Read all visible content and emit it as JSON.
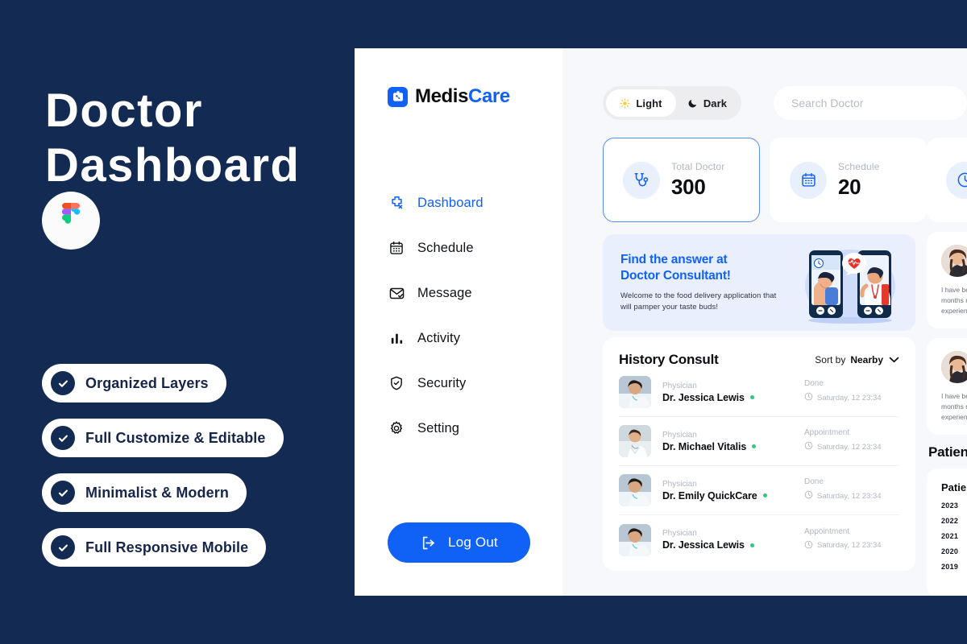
{
  "promo": {
    "title": "Doctor\nDashboard",
    "figma_icon": "figma-logo",
    "features": [
      {
        "label": "Organized Layers",
        "icon": "check-icon"
      },
      {
        "label": "Full Customize & Editable",
        "icon": "check-icon"
      },
      {
        "label": "Minimalist & Modern",
        "icon": "check-icon"
      },
      {
        "label": "Full Responsive Mobile",
        "icon": "check-icon"
      }
    ]
  },
  "colors": {
    "promo_bg": "#132a53",
    "accent_blue": "#1061f5",
    "app_bg": "#f6f8fc",
    "card_bg": "#ffffff",
    "banner_bg": "#e9effd",
    "online_green": "#2ecb7d",
    "muted_text": "#b2b6bf"
  },
  "sidebar": {
    "logo": {
      "mark_icon": "medical-bag-icon",
      "text_primary": "Medis",
      "text_accent": "Care"
    },
    "items": [
      {
        "label": "Dashboard",
        "icon": "dashboard-cross-icon",
        "active": true
      },
      {
        "label": "Schedule",
        "icon": "calendar-icon",
        "active": false
      },
      {
        "label": "Message",
        "icon": "envelope-check-icon",
        "active": false
      },
      {
        "label": "Activity",
        "icon": "bar-chart-icon",
        "active": false
      },
      {
        "label": "Security",
        "icon": "shield-check-icon",
        "active": false
      },
      {
        "label": "Setting",
        "icon": "gear-icon",
        "active": false
      }
    ],
    "logout": {
      "label": "Log Out",
      "icon": "logout-arrow-icon"
    }
  },
  "topbar": {
    "theme": {
      "light_label": "Light",
      "light_icon": "sun-icon",
      "dark_label": "Dark",
      "dark_icon": "moon-icon",
      "selected": "Light"
    },
    "search": {
      "placeholder": "Search Doctor",
      "value": "",
      "icon": "search-icon"
    }
  },
  "stats": [
    {
      "title": "Total Doctor",
      "value": "300",
      "icon": "stethoscope-icon",
      "active": true
    },
    {
      "title": "Schedule",
      "value": "20",
      "icon": "calendar-icon",
      "active": false
    },
    {
      "title": "",
      "value": "",
      "icon": "clock-icon",
      "active": false
    }
  ],
  "banner": {
    "heading": "Find the answer at\nDoctor Consultant!",
    "subtext": "Welcome to the food delivery application that\nwill pamper your taste buds!",
    "art": "telemedicine-illustration"
  },
  "history": {
    "title": "History Consult",
    "sort_label": "Sort by",
    "sort_value": "Nearby",
    "sort_icon": "chevron-down-icon",
    "rows": [
      {
        "role": "Physician",
        "name": "Dr. Jessica Lewis",
        "status": "Done",
        "time": "Saturday, 12 23:34",
        "online": true,
        "avatar": "doctor-jessica-avatar"
      },
      {
        "role": "Physician",
        "name": "Dr. Michael Vitalis",
        "status": "Appointment",
        "time": "Saturday, 12 23:34",
        "online": true,
        "avatar": "doctor-michael-avatar"
      },
      {
        "role": "Physician",
        "name": "Dr. Emily QuickCare",
        "status": "Done",
        "time": "Saturday, 12 23:34",
        "online": true,
        "avatar": "doctor-emily-avatar"
      },
      {
        "role": "Physician",
        "name": "Dr. Jessica Lewis",
        "status": "Appointment",
        "time": "Saturday, 12 23:34",
        "online": true,
        "avatar": "doctor-jessica-avatar"
      }
    ],
    "clock_icon": "clock-icon"
  },
  "right_column": {
    "testimonials": [
      {
        "avatar": "patient-avatar",
        "text": "I have been\nmonths no\nexperience"
      },
      {
        "avatar": "patient-avatar",
        "text": "I have been\nmonths no\nexperience"
      }
    ],
    "graph_title": "Patient G",
    "graph": {
      "header": "Patient",
      "years": [
        "2023",
        "2022",
        "2021",
        "2020",
        "2019"
      ]
    }
  },
  "chart_data": {
    "type": "bar",
    "title": "Patient Graph",
    "categories": [
      "2023",
      "2022",
      "2021",
      "2020",
      "2019"
    ],
    "values": [
      null,
      null,
      null,
      null,
      null
    ],
    "xlabel": "",
    "ylabel": "",
    "note": "Chart is cropped at the right viewport edge; only year tick labels are visible."
  }
}
